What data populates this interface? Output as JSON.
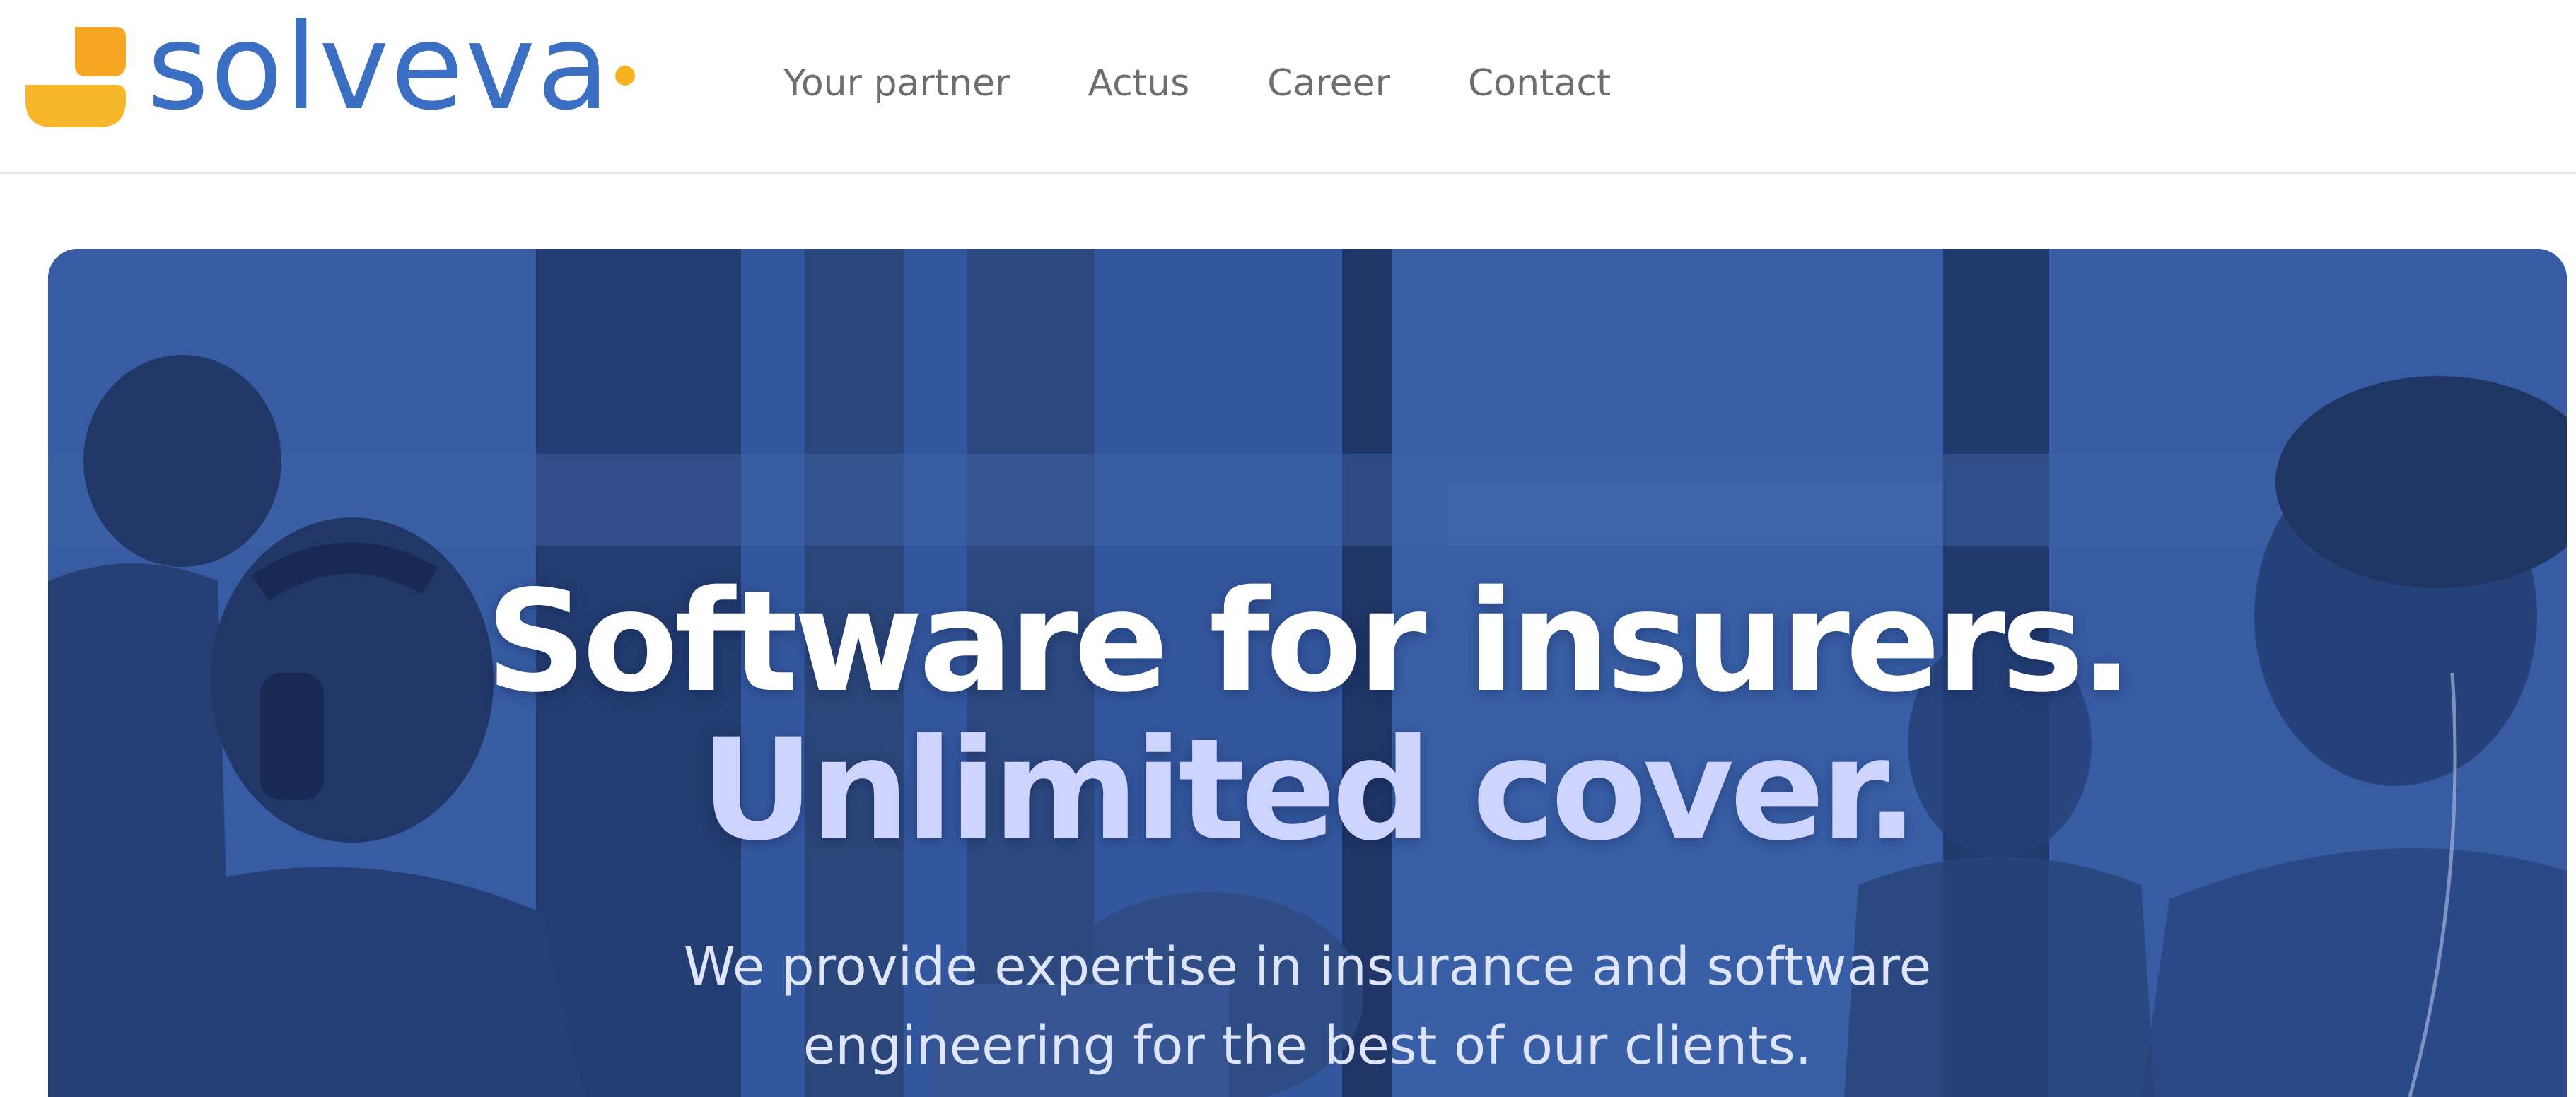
{
  "header": {
    "logo": {
      "wordmark": "solveva",
      "icon": "solveva-logo-mark-icon",
      "brand_blue": "#3a6fc4",
      "brand_orange": "#f5a623"
    },
    "nav": [
      {
        "label": "Your partner"
      },
      {
        "label": "Actus"
      },
      {
        "label": "Career"
      },
      {
        "label": "Contact"
      }
    ]
  },
  "hero": {
    "title_line1": "Software for insurers.",
    "title_line2": "Unlimited cover.",
    "subtitle_line1": "We provide expertise in insurance and software",
    "subtitle_line2": "engineering for the best of our clients.",
    "overlay_color": "#2f529a",
    "title_accent_color": "#cdd4ff"
  }
}
